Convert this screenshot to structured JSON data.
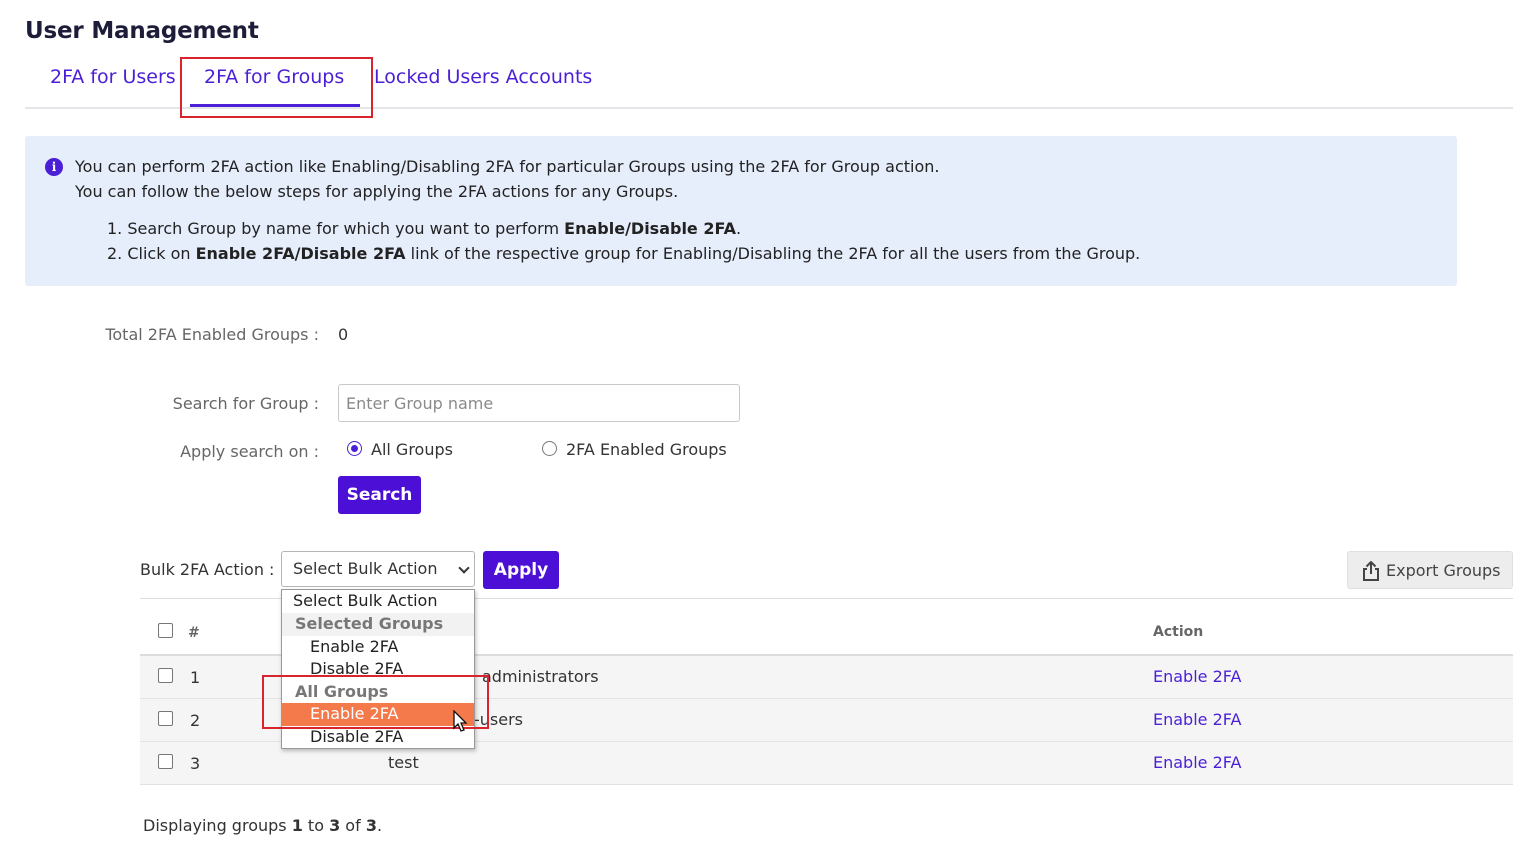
{
  "page": {
    "title": "User Management"
  },
  "tabs": [
    {
      "label": "2FA for Users"
    },
    {
      "label": "2FA for Groups",
      "active": true
    },
    {
      "label": "Locked Users Accounts"
    }
  ],
  "info": {
    "line1": "You can perform 2FA action like Enabling/Disabling 2FA for particular Groups using the 2FA for Group action.",
    "line2": "You can follow the below steps for applying the 2FA actions for any Groups.",
    "step1_prefix": "1. Search Group by name for which you want to perform ",
    "step1_bold": "Enable/Disable 2FA",
    "step1_suffix": ".",
    "step2_prefix": "2. Click on ",
    "step2_bold": "Enable 2FA/Disable 2FA",
    "step2_suffix": " link of the respective group for Enabling/Disabling the 2FA for all the users from the Group."
  },
  "stats": {
    "label": "Total 2FA Enabled Groups :",
    "value": "0"
  },
  "search": {
    "label": "Search for Group :",
    "placeholder": "Enter Group name",
    "value": "",
    "apply_on_label": "Apply search on :",
    "options": [
      {
        "label": "All Groups",
        "checked": true
      },
      {
        "label": "2FA Enabled Groups",
        "checked": false
      }
    ],
    "button_label": "Search"
  },
  "bulk": {
    "label": "Bulk 2FA Action :",
    "selected": "Select Bulk Action",
    "apply_label": "Apply",
    "dropdown": {
      "placeholder": "Select Bulk Action",
      "groups": [
        {
          "label": "Selected Groups",
          "items": [
            "Enable 2FA",
            "Disable 2FA"
          ]
        },
        {
          "label": "All Groups",
          "items": [
            "Enable 2FA",
            "Disable 2FA"
          ]
        }
      ],
      "highlighted": "All Groups / Enable 2FA"
    }
  },
  "export": {
    "label": "Export Groups",
    "icon": "export-icon"
  },
  "table": {
    "headers": {
      "number": "#",
      "action": "Action"
    },
    "rows": [
      {
        "number": "1",
        "name_visible": "administrators",
        "action": "Enable 2FA"
      },
      {
        "number": "2",
        "name_visible": "-users",
        "action": "Enable 2FA"
      },
      {
        "number": "3",
        "name_visible": "test",
        "action": "Enable 2FA"
      }
    ]
  },
  "footer": {
    "prefix": "Displaying groups ",
    "from": "1",
    "to_word": " to ",
    "to": "3",
    "of_word": " of ",
    "total": "3",
    "suffix": "."
  },
  "colors": {
    "accent": "#4b1fd6",
    "button": "#4b0fd6",
    "info_bg": "#e6edfb",
    "highlight": "#d8242c",
    "option_selected": "#f47a4c"
  }
}
